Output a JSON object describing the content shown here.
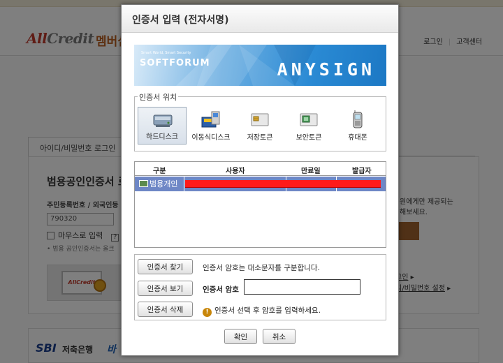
{
  "background": {
    "logo": {
      "part1": "All",
      "part2": "Credit"
    },
    "member_title": "멤버십",
    "topnav": {
      "login": "로그인",
      "separator": "|",
      "customer_center": "고객센터"
    },
    "login_tab": "아이디/비밀번호 로그인",
    "cert_heading": "범용공인인증서 로",
    "reg_label": "주민등록번호 / 외국인등",
    "reg_value": "790320",
    "mouse_input_label": "마우스로 입력",
    "help_mark": "?",
    "note": "• 범용 공인인증서는 올크",
    "illus_text": "AllCredit",
    "right_text": [
      "원에게만 제공되는",
      "해보세요."
    ],
    "right_links": [
      "그인",
      "디/비밀번호 설정"
    ],
    "banner": {
      "sbi": "SBI",
      "bank": "저축은행",
      "tail": "바"
    }
  },
  "dialog": {
    "title": "인증서 입력 (전자서명)",
    "brand": {
      "tagline": "Smart World, Smart Security",
      "softforum": "SOFTFORUM",
      "anysign": "ANYSIGN"
    },
    "location": {
      "label": "인증서 위치",
      "items": [
        {
          "label": "하드디스크",
          "icon": "hard-disk-icon",
          "selected": true
        },
        {
          "label": "이동식디스크",
          "icon": "removable-disk-icon",
          "selected": false
        },
        {
          "label": "저장토큰",
          "icon": "storage-token-icon",
          "selected": false
        },
        {
          "label": "보안토큰",
          "icon": "security-token-icon",
          "selected": false
        },
        {
          "label": "휴대폰",
          "icon": "mobile-phone-icon",
          "selected": false
        }
      ]
    },
    "cert_table": {
      "columns": [
        "구분",
        "사용자",
        "만료일",
        "발급자"
      ],
      "rows": [
        {
          "type": "범용개인"
        }
      ]
    },
    "operations": {
      "find_button": "인증서 찾기",
      "view_button": "인증서 보기",
      "delete_button": "인증서 삭제",
      "case_notice": "인증서 암호는 대소문자를 구분합니다.",
      "password_label": "인증서 암호",
      "password_value": "",
      "warning_text": "인증서 선택 후 암호를 입력하세요."
    },
    "confirm_button": "확인",
    "cancel_button": "취소"
  }
}
